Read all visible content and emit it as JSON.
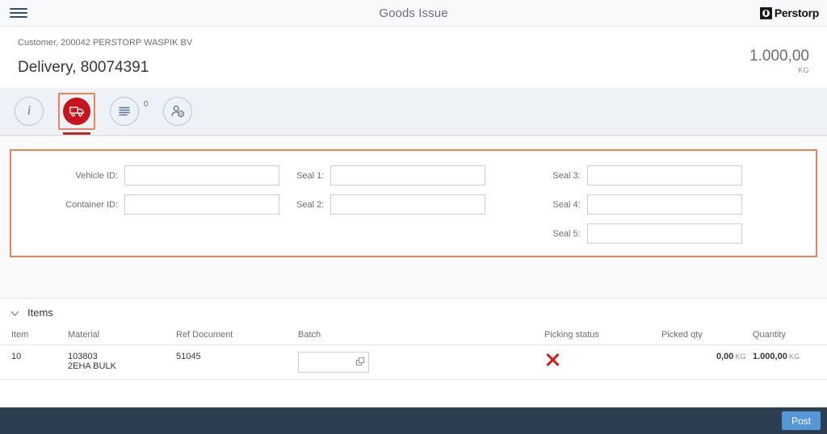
{
  "shell": {
    "menu_icon": "hamburger-menu-icon",
    "title": "Goods Issue",
    "brand_name": "Perstorp",
    "brand_mark_icon": "perstorp-logo-icon"
  },
  "object_header": {
    "customer_line": "Customer, 200042 PERSTORP WASPIK BV",
    "delivery_title": "Delivery, 80074391",
    "quantity_value": "1.000,00",
    "quantity_unit": "KG"
  },
  "tabbar": {
    "tabs": [
      {
        "name": "info-tab",
        "icon": "info-icon",
        "glyph": "i",
        "selected": false
      },
      {
        "name": "transport-tab",
        "icon": "truck-icon",
        "glyph": "truck",
        "selected": true
      },
      {
        "name": "notes-tab",
        "icon": "list-icon",
        "glyph": "list",
        "selected": false,
        "badge": "0"
      },
      {
        "name": "contacts-tab",
        "icon": "person-at-icon",
        "glyph": "person",
        "selected": false
      }
    ],
    "selection_color": "#c4161c",
    "focus_color": "#e8845a"
  },
  "form": {
    "border_color": "#e8845a",
    "columns": [
      {
        "name": "vehicle-column",
        "fields": [
          {
            "name": "vehicle-id-field",
            "label": "Vehicle ID:",
            "value": "",
            "placeholder": ""
          },
          {
            "name": "container-id-field",
            "label": "Container ID:",
            "value": "",
            "placeholder": ""
          }
        ]
      },
      {
        "name": "seal-column-left",
        "fields": [
          {
            "name": "seal-1-field",
            "label": "Seal 1:",
            "value": "",
            "placeholder": ""
          },
          {
            "name": "seal-2-field",
            "label": "Seal 2:",
            "value": "",
            "placeholder": ""
          }
        ]
      },
      {
        "name": "seal-column-right",
        "fields": [
          {
            "name": "seal-3-field",
            "label": "Seal 3:",
            "value": "",
            "placeholder": ""
          },
          {
            "name": "seal-4-field",
            "label": "Seal 4:",
            "value": "",
            "placeholder": ""
          },
          {
            "name": "seal-5-field",
            "label": "Seal 5:",
            "value": "",
            "placeholder": ""
          }
        ]
      }
    ]
  },
  "items": {
    "section_title": "Items",
    "expanded": true,
    "columns": {
      "item": "Item",
      "material": "Material",
      "ref_document": "Ref Document",
      "batch": "Batch",
      "picking_status": "Picking status",
      "picked_qty": "Picked qty",
      "quantity": "Quantity"
    },
    "rows": [
      {
        "item": "10",
        "material_number": "103803",
        "material_text": "2EHA BULK",
        "ref_document": "51045",
        "batch_value": "",
        "batch_placeholder": "",
        "picking_status_icon": "red-x-icon",
        "picked_qty_value": "0,00",
        "picked_qty_unit": "KG",
        "quantity_value": "1.000,00",
        "quantity_unit": "KG",
        "nav_icon": "chevron-right-icon"
      }
    ]
  },
  "footer": {
    "post_label": "Post",
    "bar_color": "#2c3e50",
    "button_color": "#5596d6"
  }
}
